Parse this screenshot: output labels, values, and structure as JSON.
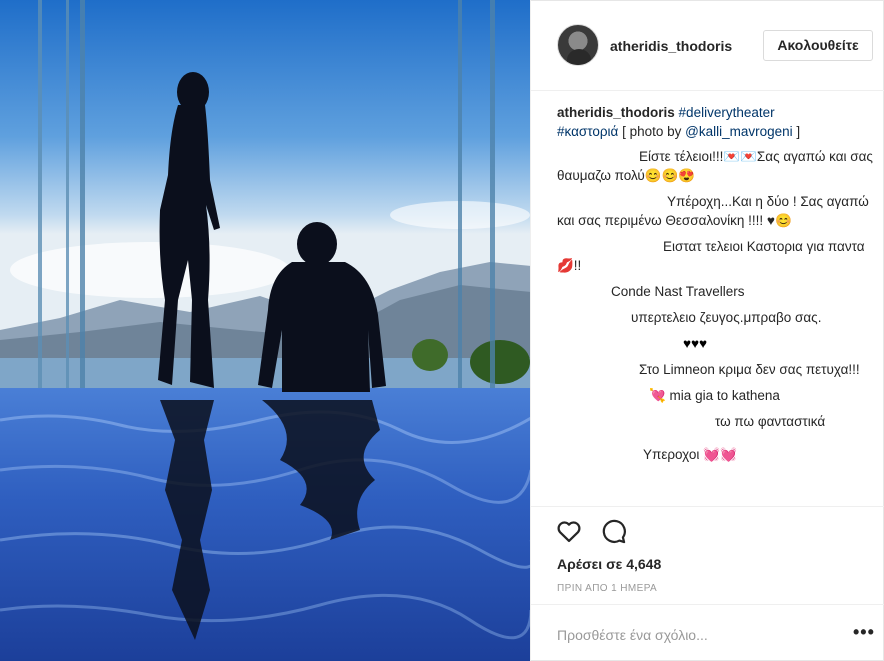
{
  "post": {
    "username": "atheridis_thodoris",
    "follow_label": "Ακολουθείτε",
    "caption": {
      "user": "atheridis_thodoris",
      "tag1": "#deliverytheater",
      "tag2": "#καστοριά",
      "text_mid": " [ photo by ",
      "mention": "@kalli_mavrogeni",
      "text_end": " ]"
    },
    "comments": [
      "Είστε τέλειοι!!!💌💌Σας αγαπώ και σας θαυμαζω πολύ😊😊😍",
      "Υπέροχη...Και η δύο ! Σας αγαπώ και σας περιμένω Θεσσαλονίκη !!!! ♥😊",
      "Ειστατ τελειοι Καστορια για παντα💋!!",
      "Conde Nast Travellers",
      "υπερτελειο ζευγος.μπραβο σας.",
      "♥♥♥",
      "Στο Limneon κριμα δεν σας πετυχα!!!",
      "💘 mia gia to kathena",
      "τω πω φανταστικά",
      "Υπεροχοι 💓💓"
    ],
    "likes": "Αρέσει σε 4,648",
    "time": "ΠΡΙΝ ΑΠΟ 1 ΗΜΕΡΑ",
    "add_comment_placeholder": "Προσθέστε ένα σχόλιο...",
    "more_label": "•••",
    "icons": {
      "like": "heart-outline-icon",
      "comment": "speech-bubble-icon",
      "more": "ellipsis-icon"
    }
  }
}
